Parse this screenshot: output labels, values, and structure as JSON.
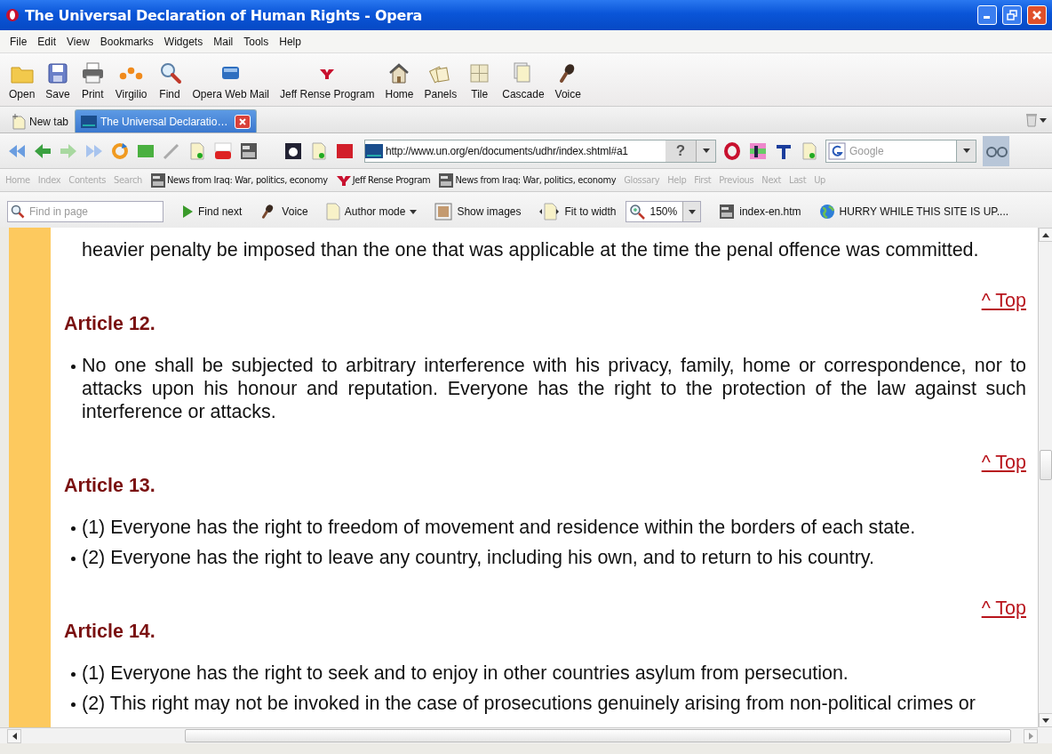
{
  "window": {
    "title": "The Universal Declaration of Human Rights - Opera"
  },
  "menu": [
    "File",
    "Edit",
    "View",
    "Bookmarks",
    "Widgets",
    "Mail",
    "Tools",
    "Help"
  ],
  "toolbar": [
    {
      "label": "Open",
      "kind": "folder"
    },
    {
      "label": "Save",
      "kind": "floppy"
    },
    {
      "label": "Print",
      "kind": "printer"
    },
    {
      "label": "Virgilio",
      "kind": "dots"
    },
    {
      "label": "Find",
      "kind": "magnifier"
    },
    {
      "label": "Opera Web Mail",
      "kind": "mail"
    },
    {
      "label": "Jeff Rense Program",
      "kind": "logo"
    },
    {
      "label": "Home",
      "kind": "house"
    },
    {
      "label": "Panels",
      "kind": "panels"
    },
    {
      "label": "Tile",
      "kind": "tile"
    },
    {
      "label": "Cascade",
      "kind": "cascade"
    },
    {
      "label": "Voice",
      "kind": "microphone"
    }
  ],
  "tabs": [
    {
      "label": "New tab",
      "selected": false
    },
    {
      "label": "The Universal Declaratio…",
      "selected": true
    }
  ],
  "address": {
    "url": "http://www.un.org/en/documents/udhr/index.shtml#a1",
    "help": "?"
  },
  "search": {
    "placeholder": "Google"
  },
  "links_bar": [
    {
      "label": "Home",
      "kind": "plain",
      "disabled": true
    },
    {
      "label": "Index",
      "kind": "plain",
      "disabled": true
    },
    {
      "label": "Contents",
      "kind": "plain",
      "disabled": true
    },
    {
      "label": "Search",
      "kind": "plain",
      "disabled": true
    },
    {
      "label": "News from Iraq: War, politics, economy",
      "kind": "news",
      "disabled": false
    },
    {
      "label": "Jeff Rense Program",
      "kind": "logo",
      "disabled": false
    },
    {
      "label": "News from Iraq: War, politics, economy",
      "kind": "news",
      "disabled": false
    },
    {
      "label": "Glossary",
      "kind": "plain",
      "disabled": true
    },
    {
      "label": "Help",
      "kind": "plain",
      "disabled": true
    },
    {
      "label": "First",
      "kind": "plain",
      "disabled": true
    },
    {
      "label": "Previous",
      "kind": "plain",
      "disabled": true
    },
    {
      "label": "Next",
      "kind": "plain",
      "disabled": true
    },
    {
      "label": "Last",
      "kind": "plain",
      "disabled": true
    },
    {
      "label": "Up",
      "kind": "plain",
      "disabled": true
    }
  ],
  "find_bar": {
    "placeholder": "Find in page",
    "items": [
      {
        "label": "Find next",
        "kind": "play"
      },
      {
        "label": "Voice",
        "kind": "microphone"
      },
      {
        "label": "Author mode",
        "kind": "menu"
      },
      {
        "label": "Show images",
        "kind": "image"
      },
      {
        "label": "Fit to width",
        "kind": "fit"
      },
      {
        "label": "150%",
        "kind": "zoom"
      },
      {
        "label": "index-en.htm",
        "kind": "news"
      },
      {
        "label": "HURRY WHILE THIS SITE IS UP....",
        "kind": "globe"
      }
    ]
  },
  "content": [
    {
      "kind": "paragraph",
      "text": "heavier penalty be imposed than the one that was applicable at the time the penal offence was committed."
    },
    {
      "kind": "top_link",
      "text": "^ Top"
    },
    {
      "kind": "heading",
      "text": "Article 12."
    },
    {
      "kind": "bullet",
      "text": "No one shall be subjected to arbitrary interference with his privacy, family, home or correspondence, nor to attacks upon his honour and reputation. Everyone has the right to the protection of the law against such interference or attacks."
    },
    {
      "kind": "top_link",
      "text": "^ Top"
    },
    {
      "kind": "heading",
      "text": "Article 13."
    },
    {
      "kind": "bullet",
      "text": "(1) Everyone has the right to freedom of movement and residence within the borders of each state."
    },
    {
      "kind": "bullet",
      "text": "(2) Everyone has the right to leave any country, including his own, and to return to his country."
    },
    {
      "kind": "top_link",
      "text": "^ Top"
    },
    {
      "kind": "heading",
      "text": "Article 14."
    },
    {
      "kind": "bullet",
      "text": "(1) Everyone has the right to seek and to enjoy in other countries asylum from persecution."
    },
    {
      "kind": "bullet",
      "text": "(2) This right may not be invoked in the case of prosecutions genuinely arising from non-political crimes or"
    }
  ]
}
